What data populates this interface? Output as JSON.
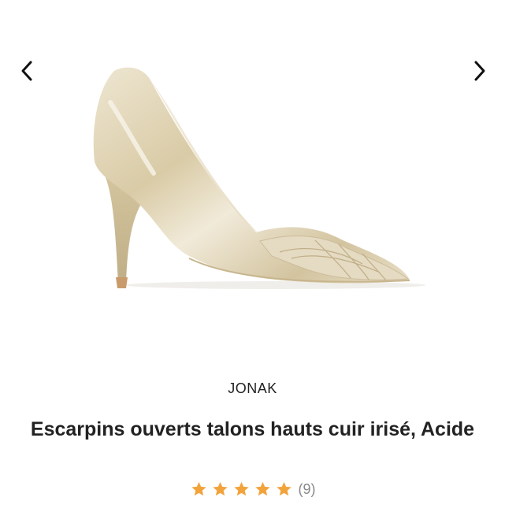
{
  "product": {
    "brand": "JONAK",
    "title": "Escarpins ouverts talons hauts cuir irisé, Acide",
    "rating": 5,
    "rating_max": 5,
    "review_count": "(9)",
    "image": "gold-metallic-peep-toe-pump"
  },
  "gallery": {
    "prev_icon": "chevron-left-icon",
    "next_icon": "chevron-right-icon"
  },
  "colors": {
    "star": "#f2a33c",
    "text": "#222222",
    "muted": "#888888",
    "shoe_gold": "#e6dcc3"
  }
}
